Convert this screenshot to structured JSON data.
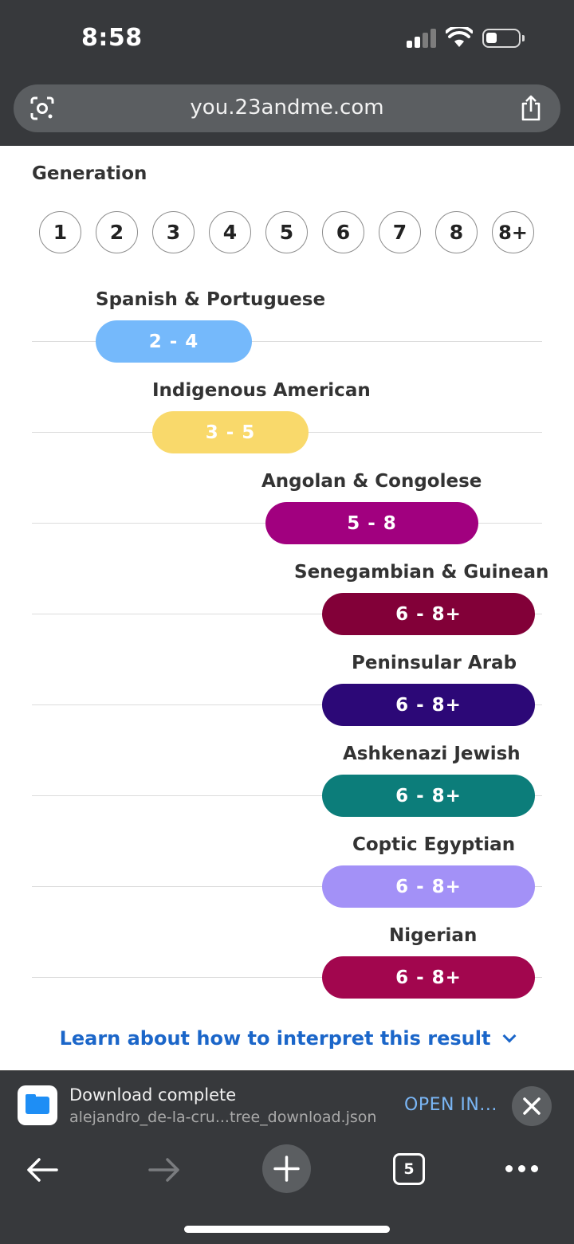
{
  "status_bar": {
    "time": "8:58"
  },
  "browser": {
    "url": "you.23andme.com",
    "icons": {
      "lens": "google-lens-icon",
      "share": "share-icon"
    }
  },
  "generation": {
    "title": "Generation",
    "numbers": [
      "1",
      "2",
      "3",
      "4",
      "5",
      "6",
      "7",
      "8",
      "8+"
    ]
  },
  "ancestries": [
    {
      "name": "Spanish & Portuguese",
      "range": "2 - 4",
      "color": "#75b9fb"
    },
    {
      "name": "Indigenous American",
      "range": "3 - 5",
      "color": "#f9d96b"
    },
    {
      "name": "Angolan & Congolese",
      "range": "5 - 8",
      "color": "#a1007f"
    },
    {
      "name": "Senegambian & Guinean",
      "range": "6 - 8+",
      "color": "#820038"
    },
    {
      "name": "Peninsular Arab",
      "range": "6 - 8+",
      "color": "#2c0877"
    },
    {
      "name": "Ashkenazi Jewish",
      "range": "6 - 8+",
      "color": "#0c7d7a"
    },
    {
      "name": "Coptic Egyptian",
      "range": "6 - 8+",
      "color": "#a391f7"
    },
    {
      "name": "Nigerian",
      "range": "6 - 8+",
      "color": "#a2064e"
    }
  ],
  "learn_link": "Learn about how to interpret this result",
  "download": {
    "title": "Download complete",
    "filename": "alejandro_de-la-cru...tree_download.json",
    "open_label": "OPEN IN..."
  },
  "toolbar": {
    "tab_count": "5"
  }
}
